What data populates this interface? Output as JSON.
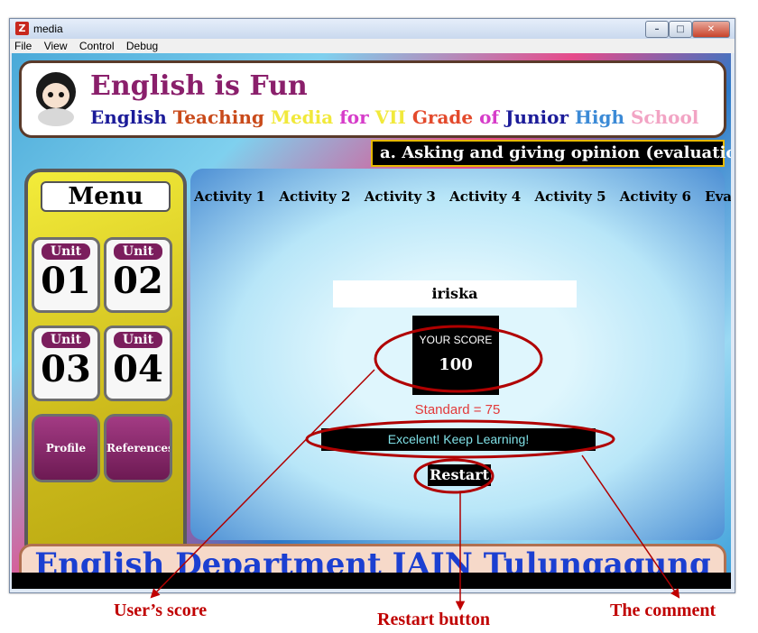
{
  "window": {
    "title": "media",
    "menu": [
      "File",
      "View",
      "Control",
      "Debug"
    ]
  },
  "header": {
    "title": "English is Fun",
    "subtitle_parts": [
      "English ",
      "Teaching ",
      "Media ",
      "for ",
      "VII ",
      "Grade ",
      "of ",
      "Junior ",
      "High ",
      "School"
    ],
    "topic": "a. Asking and giving opinion (evaluation)"
  },
  "sidebar": {
    "menu_title": "Menu",
    "units": [
      {
        "label": "Unit",
        "number": "01"
      },
      {
        "label": "Unit",
        "number": "02"
      },
      {
        "label": "Unit",
        "number": "03"
      },
      {
        "label": "Unit",
        "number": "04"
      }
    ],
    "profile": "Profile",
    "references": "References"
  },
  "main": {
    "activities": [
      "Activity 1",
      "Activity 2",
      "Activity 3",
      "Activity 4",
      "Activity 5",
      "Activity 6",
      "Evaluation"
    ],
    "user_name": "iriska",
    "score_label": "YOUR SCORE",
    "score": "100",
    "standard": "Standard = 75",
    "comment": "Excelent! Keep Learning!",
    "restart": "Restart"
  },
  "footer": "English Department IAIN Tulungagung",
  "annotations": {
    "score": "User’s score",
    "restart": "Restart button",
    "comment": "The comment"
  },
  "colors": {
    "annotation": "#c00000",
    "topic_bg": "#000000",
    "sidebar": "#f3ec3a",
    "footer_text": "#1b3fd1"
  }
}
